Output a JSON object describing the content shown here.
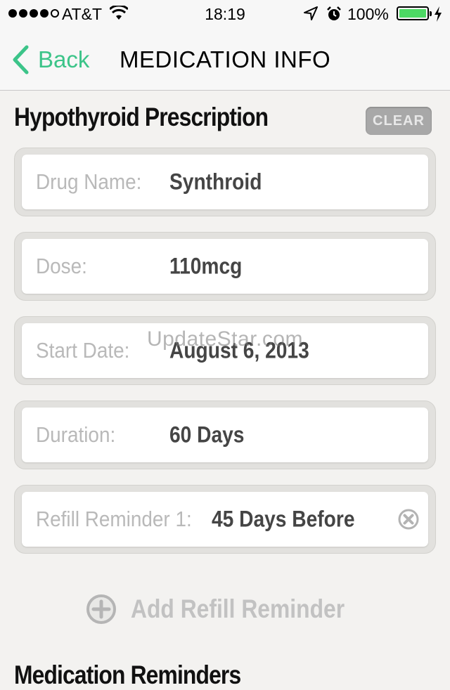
{
  "status_bar": {
    "signal_bars_filled": 4,
    "signal_bars_total": 5,
    "carrier": "AT&T",
    "time": "18:19",
    "battery_percent": "100%",
    "battery_level": 1.0,
    "icons": [
      "wifi-icon",
      "location-arrow-icon",
      "alarm-clock-icon",
      "battery-icon",
      "charging-bolt-icon"
    ]
  },
  "nav": {
    "back_label": "Back",
    "title": "MEDICATION INFO",
    "accent_color": "#3cc489"
  },
  "prescription": {
    "title": "Hypothyroid Prescription",
    "clear_label": "CLEAR",
    "fields": [
      {
        "label": "Drug Name:",
        "value": "Synthroid"
      },
      {
        "label": "Dose:",
        "value": "110mcg"
      },
      {
        "label": "Start Date:",
        "value": "August 6, 2013"
      },
      {
        "label": "Duration:",
        "value": "60 Days"
      },
      {
        "label": "Refill Reminder 1:",
        "value": "45 Days Before"
      }
    ],
    "add_refill_label": "Add Refill Reminder"
  },
  "watermark": "UpdateStar.com",
  "next_section_title": "Medication Reminders"
}
